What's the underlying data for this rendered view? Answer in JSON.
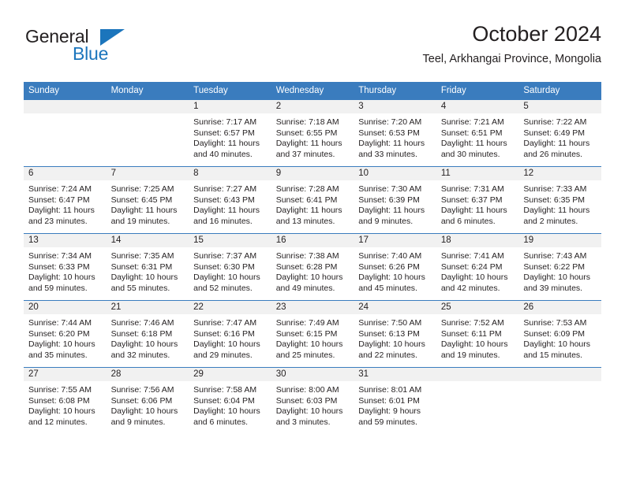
{
  "brand": {
    "name_part1": "General",
    "name_part2": "Blue",
    "accent_color": "#1b75bc"
  },
  "header": {
    "title": "October 2024",
    "subtitle": "Teel, Arkhangai Province, Mongolia",
    "header_bg_color": "#3a7cbe",
    "daynum_band_color": "#f1f1f1"
  },
  "weekdays": [
    "Sunday",
    "Monday",
    "Tuesday",
    "Wednesday",
    "Thursday",
    "Friday",
    "Saturday"
  ],
  "weeks": [
    [
      {
        "day": "",
        "sunrise": "",
        "sunset": "",
        "daylight_line1": "",
        "daylight_line2": ""
      },
      {
        "day": "",
        "sunrise": "",
        "sunset": "",
        "daylight_line1": "",
        "daylight_line2": ""
      },
      {
        "day": "1",
        "sunrise": "Sunrise: 7:17 AM",
        "sunset": "Sunset: 6:57 PM",
        "daylight_line1": "Daylight: 11 hours",
        "daylight_line2": "and 40 minutes."
      },
      {
        "day": "2",
        "sunrise": "Sunrise: 7:18 AM",
        "sunset": "Sunset: 6:55 PM",
        "daylight_line1": "Daylight: 11 hours",
        "daylight_line2": "and 37 minutes."
      },
      {
        "day": "3",
        "sunrise": "Sunrise: 7:20 AM",
        "sunset": "Sunset: 6:53 PM",
        "daylight_line1": "Daylight: 11 hours",
        "daylight_line2": "and 33 minutes."
      },
      {
        "day": "4",
        "sunrise": "Sunrise: 7:21 AM",
        "sunset": "Sunset: 6:51 PM",
        "daylight_line1": "Daylight: 11 hours",
        "daylight_line2": "and 30 minutes."
      },
      {
        "day": "5",
        "sunrise": "Sunrise: 7:22 AM",
        "sunset": "Sunset: 6:49 PM",
        "daylight_line1": "Daylight: 11 hours",
        "daylight_line2": "and 26 minutes."
      }
    ],
    [
      {
        "day": "6",
        "sunrise": "Sunrise: 7:24 AM",
        "sunset": "Sunset: 6:47 PM",
        "daylight_line1": "Daylight: 11 hours",
        "daylight_line2": "and 23 minutes."
      },
      {
        "day": "7",
        "sunrise": "Sunrise: 7:25 AM",
        "sunset": "Sunset: 6:45 PM",
        "daylight_line1": "Daylight: 11 hours",
        "daylight_line2": "and 19 minutes."
      },
      {
        "day": "8",
        "sunrise": "Sunrise: 7:27 AM",
        "sunset": "Sunset: 6:43 PM",
        "daylight_line1": "Daylight: 11 hours",
        "daylight_line2": "and 16 minutes."
      },
      {
        "day": "9",
        "sunrise": "Sunrise: 7:28 AM",
        "sunset": "Sunset: 6:41 PM",
        "daylight_line1": "Daylight: 11 hours",
        "daylight_line2": "and 13 minutes."
      },
      {
        "day": "10",
        "sunrise": "Sunrise: 7:30 AM",
        "sunset": "Sunset: 6:39 PM",
        "daylight_line1": "Daylight: 11 hours",
        "daylight_line2": "and 9 minutes."
      },
      {
        "day": "11",
        "sunrise": "Sunrise: 7:31 AM",
        "sunset": "Sunset: 6:37 PM",
        "daylight_line1": "Daylight: 11 hours",
        "daylight_line2": "and 6 minutes."
      },
      {
        "day": "12",
        "sunrise": "Sunrise: 7:33 AM",
        "sunset": "Sunset: 6:35 PM",
        "daylight_line1": "Daylight: 11 hours",
        "daylight_line2": "and 2 minutes."
      }
    ],
    [
      {
        "day": "13",
        "sunrise": "Sunrise: 7:34 AM",
        "sunset": "Sunset: 6:33 PM",
        "daylight_line1": "Daylight: 10 hours",
        "daylight_line2": "and 59 minutes."
      },
      {
        "day": "14",
        "sunrise": "Sunrise: 7:35 AM",
        "sunset": "Sunset: 6:31 PM",
        "daylight_line1": "Daylight: 10 hours",
        "daylight_line2": "and 55 minutes."
      },
      {
        "day": "15",
        "sunrise": "Sunrise: 7:37 AM",
        "sunset": "Sunset: 6:30 PM",
        "daylight_line1": "Daylight: 10 hours",
        "daylight_line2": "and 52 minutes."
      },
      {
        "day": "16",
        "sunrise": "Sunrise: 7:38 AM",
        "sunset": "Sunset: 6:28 PM",
        "daylight_line1": "Daylight: 10 hours",
        "daylight_line2": "and 49 minutes."
      },
      {
        "day": "17",
        "sunrise": "Sunrise: 7:40 AM",
        "sunset": "Sunset: 6:26 PM",
        "daylight_line1": "Daylight: 10 hours",
        "daylight_line2": "and 45 minutes."
      },
      {
        "day": "18",
        "sunrise": "Sunrise: 7:41 AM",
        "sunset": "Sunset: 6:24 PM",
        "daylight_line1": "Daylight: 10 hours",
        "daylight_line2": "and 42 minutes."
      },
      {
        "day": "19",
        "sunrise": "Sunrise: 7:43 AM",
        "sunset": "Sunset: 6:22 PM",
        "daylight_line1": "Daylight: 10 hours",
        "daylight_line2": "and 39 minutes."
      }
    ],
    [
      {
        "day": "20",
        "sunrise": "Sunrise: 7:44 AM",
        "sunset": "Sunset: 6:20 PM",
        "daylight_line1": "Daylight: 10 hours",
        "daylight_line2": "and 35 minutes."
      },
      {
        "day": "21",
        "sunrise": "Sunrise: 7:46 AM",
        "sunset": "Sunset: 6:18 PM",
        "daylight_line1": "Daylight: 10 hours",
        "daylight_line2": "and 32 minutes."
      },
      {
        "day": "22",
        "sunrise": "Sunrise: 7:47 AM",
        "sunset": "Sunset: 6:16 PM",
        "daylight_line1": "Daylight: 10 hours",
        "daylight_line2": "and 29 minutes."
      },
      {
        "day": "23",
        "sunrise": "Sunrise: 7:49 AM",
        "sunset": "Sunset: 6:15 PM",
        "daylight_line1": "Daylight: 10 hours",
        "daylight_line2": "and 25 minutes."
      },
      {
        "day": "24",
        "sunrise": "Sunrise: 7:50 AM",
        "sunset": "Sunset: 6:13 PM",
        "daylight_line1": "Daylight: 10 hours",
        "daylight_line2": "and 22 minutes."
      },
      {
        "day": "25",
        "sunrise": "Sunrise: 7:52 AM",
        "sunset": "Sunset: 6:11 PM",
        "daylight_line1": "Daylight: 10 hours",
        "daylight_line2": "and 19 minutes."
      },
      {
        "day": "26",
        "sunrise": "Sunrise: 7:53 AM",
        "sunset": "Sunset: 6:09 PM",
        "daylight_line1": "Daylight: 10 hours",
        "daylight_line2": "and 15 minutes."
      }
    ],
    [
      {
        "day": "27",
        "sunrise": "Sunrise: 7:55 AM",
        "sunset": "Sunset: 6:08 PM",
        "daylight_line1": "Daylight: 10 hours",
        "daylight_line2": "and 12 minutes."
      },
      {
        "day": "28",
        "sunrise": "Sunrise: 7:56 AM",
        "sunset": "Sunset: 6:06 PM",
        "daylight_line1": "Daylight: 10 hours",
        "daylight_line2": "and 9 minutes."
      },
      {
        "day": "29",
        "sunrise": "Sunrise: 7:58 AM",
        "sunset": "Sunset: 6:04 PM",
        "daylight_line1": "Daylight: 10 hours",
        "daylight_line2": "and 6 minutes."
      },
      {
        "day": "30",
        "sunrise": "Sunrise: 8:00 AM",
        "sunset": "Sunset: 6:03 PM",
        "daylight_line1": "Daylight: 10 hours",
        "daylight_line2": "and 3 minutes."
      },
      {
        "day": "31",
        "sunrise": "Sunrise: 8:01 AM",
        "sunset": "Sunset: 6:01 PM",
        "daylight_line1": "Daylight: 9 hours",
        "daylight_line2": "and 59 minutes."
      },
      {
        "day": "",
        "sunrise": "",
        "sunset": "",
        "daylight_line1": "",
        "daylight_line2": ""
      },
      {
        "day": "",
        "sunrise": "",
        "sunset": "",
        "daylight_line1": "",
        "daylight_line2": ""
      }
    ]
  ]
}
